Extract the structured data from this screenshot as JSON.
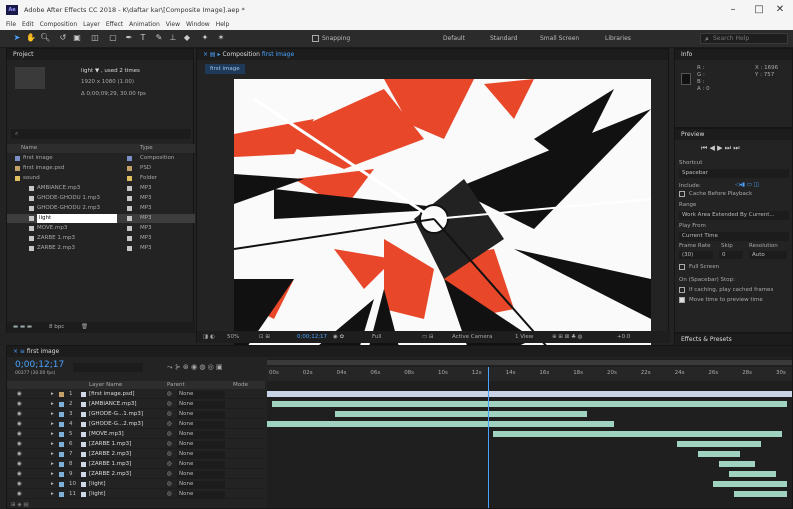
{
  "titlebar": {
    "title": "Adobe After Effects CC 2018 - K\\daftar kar\\[Composite Image].aep *",
    "minimize": "–",
    "maximize": "□",
    "close": "✕"
  },
  "menu": [
    "File",
    "Edit",
    "Composition",
    "Layer",
    "Effect",
    "Animation",
    "View",
    "Window",
    "Help"
  ],
  "toolbar": {
    "snapping": "Snapping",
    "workspaces": [
      "Default",
      "Standard",
      "Small Screen",
      "Libraries"
    ],
    "search_placeholder": "Search Help"
  },
  "project": {
    "title": "Project",
    "selected_name": "light ▼ , used 2 times",
    "selected_size": "1920 x 1080 (1.00)",
    "selected_info": "Δ 0;00;09;29, 30.00 fps",
    "search_placeholder": "⌕",
    "col_name": "Name",
    "col_type": "Type",
    "items": [
      {
        "name": "first image",
        "type": "Composition",
        "color": "#7a8fc6"
      },
      {
        "name": "first image.psd",
        "type": "PSD",
        "color": "#c6a06a"
      },
      {
        "name": "sound",
        "type": "Folder",
        "color": "#e0c060"
      },
      {
        "name": "AMBIANCE.mp3",
        "type": "MP3",
        "color": "#c6c6c6"
      },
      {
        "name": "GHODE-GHODU 1.mp3",
        "type": "MP3",
        "color": "#c6c6c6"
      },
      {
        "name": "GHODE-GHODU 2.mp3",
        "type": "MP3",
        "color": "#c6c6c6"
      },
      {
        "name": "light",
        "type": "MP3",
        "color": "#c6c6c6"
      },
      {
        "name": "MOVE.mp3",
        "type": "MP3",
        "color": "#c6c6c6"
      },
      {
        "name": "ZARBE 1.mp3",
        "type": "MP3",
        "color": "#c6c6c6"
      },
      {
        "name": "ZARBE 2.mp3",
        "type": "MP3",
        "color": "#c6c6c6"
      }
    ],
    "bpc": "8 bpc"
  },
  "comp": {
    "tab": "Composition",
    "tab_name": "first image",
    "sub_tab": "first image",
    "zoom": "50%",
    "timecode": "0;00;12;17",
    "resolution": "Full",
    "camera": "Active Camera",
    "views": "1 View",
    "offset": "+0.0"
  },
  "info": {
    "title": "Info",
    "r": "R :",
    "g": "G :",
    "b": "B :",
    "a": "A : 0",
    "x": "X : 1696",
    "y": "Y : 757"
  },
  "preview": {
    "title": "Preview",
    "shortcut_label": "Shortcut",
    "shortcut_value": "Spacebar",
    "include_label": "Include:",
    "cache_label": "Cache Before Playback",
    "range_label": "Range",
    "range_value": "Work Area Extended By Current...",
    "playfrom_label": "Play From",
    "playfrom_value": "Current Time",
    "fr_label": "Frame Rate",
    "skip_label": "Skip",
    "res_label": "Resolution",
    "fr_value": "(30)",
    "skip_value": "0",
    "res_value": "Auto",
    "fullscreen": "Full Screen",
    "onstop": "On (Spacebar) Stop:",
    "cached": "If caching, play cached frames",
    "movetime": "Move time to preview time"
  },
  "effects": {
    "title": "Effects & Presets"
  },
  "timeline": {
    "tab": "first image",
    "timecode": "0;00;12;17",
    "fps": "00377 (30.00 fps)",
    "col_source": "Layer Name",
    "col_parent": "Parent",
    "col_mode": "Mode",
    "ruler": [
      "00s",
      "02s",
      "04s",
      "06s",
      "08s",
      "10s",
      "12s",
      "14s",
      "16s",
      "18s",
      "20s",
      "22s",
      "24s",
      "26s",
      "28s",
      "30s"
    ],
    "layers": [
      {
        "num": "1",
        "name": "[first image.psd]",
        "parent": "None",
        "color": "#c6a06a",
        "start": 0.0,
        "end": 1.0
      },
      {
        "num": "2",
        "name": "[AMBIANCE.mp3]",
        "parent": "None",
        "color": "#7fb1d8",
        "start": 0.01,
        "end": 0.99
      },
      {
        "num": "3",
        "name": "[GHODE-G...1.mp3]",
        "parent": "None",
        "color": "#7fb1d8",
        "start": 0.13,
        "end": 0.61
      },
      {
        "num": "4",
        "name": "[GHODE-G...2.mp3]",
        "parent": "None",
        "color": "#7fb1d8",
        "start": 0.0,
        "end": 0.66
      },
      {
        "num": "5",
        "name": "[MOVE.mp3]",
        "parent": "None",
        "color": "#7fb1d8",
        "start": 0.43,
        "end": 0.98
      },
      {
        "num": "6",
        "name": "[ZARBE 1.mp3]",
        "parent": "None",
        "color": "#7fb1d8",
        "start": 0.78,
        "end": 0.94
      },
      {
        "num": "7",
        "name": "[ZARBE 2.mp3]",
        "parent": "None",
        "color": "#7fb1d8",
        "start": 0.82,
        "end": 0.9
      },
      {
        "num": "8",
        "name": "[ZARBE 1.mp3]",
        "parent": "None",
        "color": "#7fb1d8",
        "start": 0.86,
        "end": 0.93
      },
      {
        "num": "9",
        "name": "[ZARBE 2.mp3]",
        "parent": "None",
        "color": "#7fb1d8",
        "start": 0.88,
        "end": 0.97
      },
      {
        "num": "10",
        "name": "[light]",
        "parent": "None",
        "color": "#7fb1d8",
        "start": 0.85,
        "end": 0.99
      },
      {
        "num": "11",
        "name": "[light]",
        "parent": "None",
        "color": "#7fb1d8",
        "start": 0.89,
        "end": 0.99
      }
    ],
    "current_time_fraction": 0.42
  }
}
